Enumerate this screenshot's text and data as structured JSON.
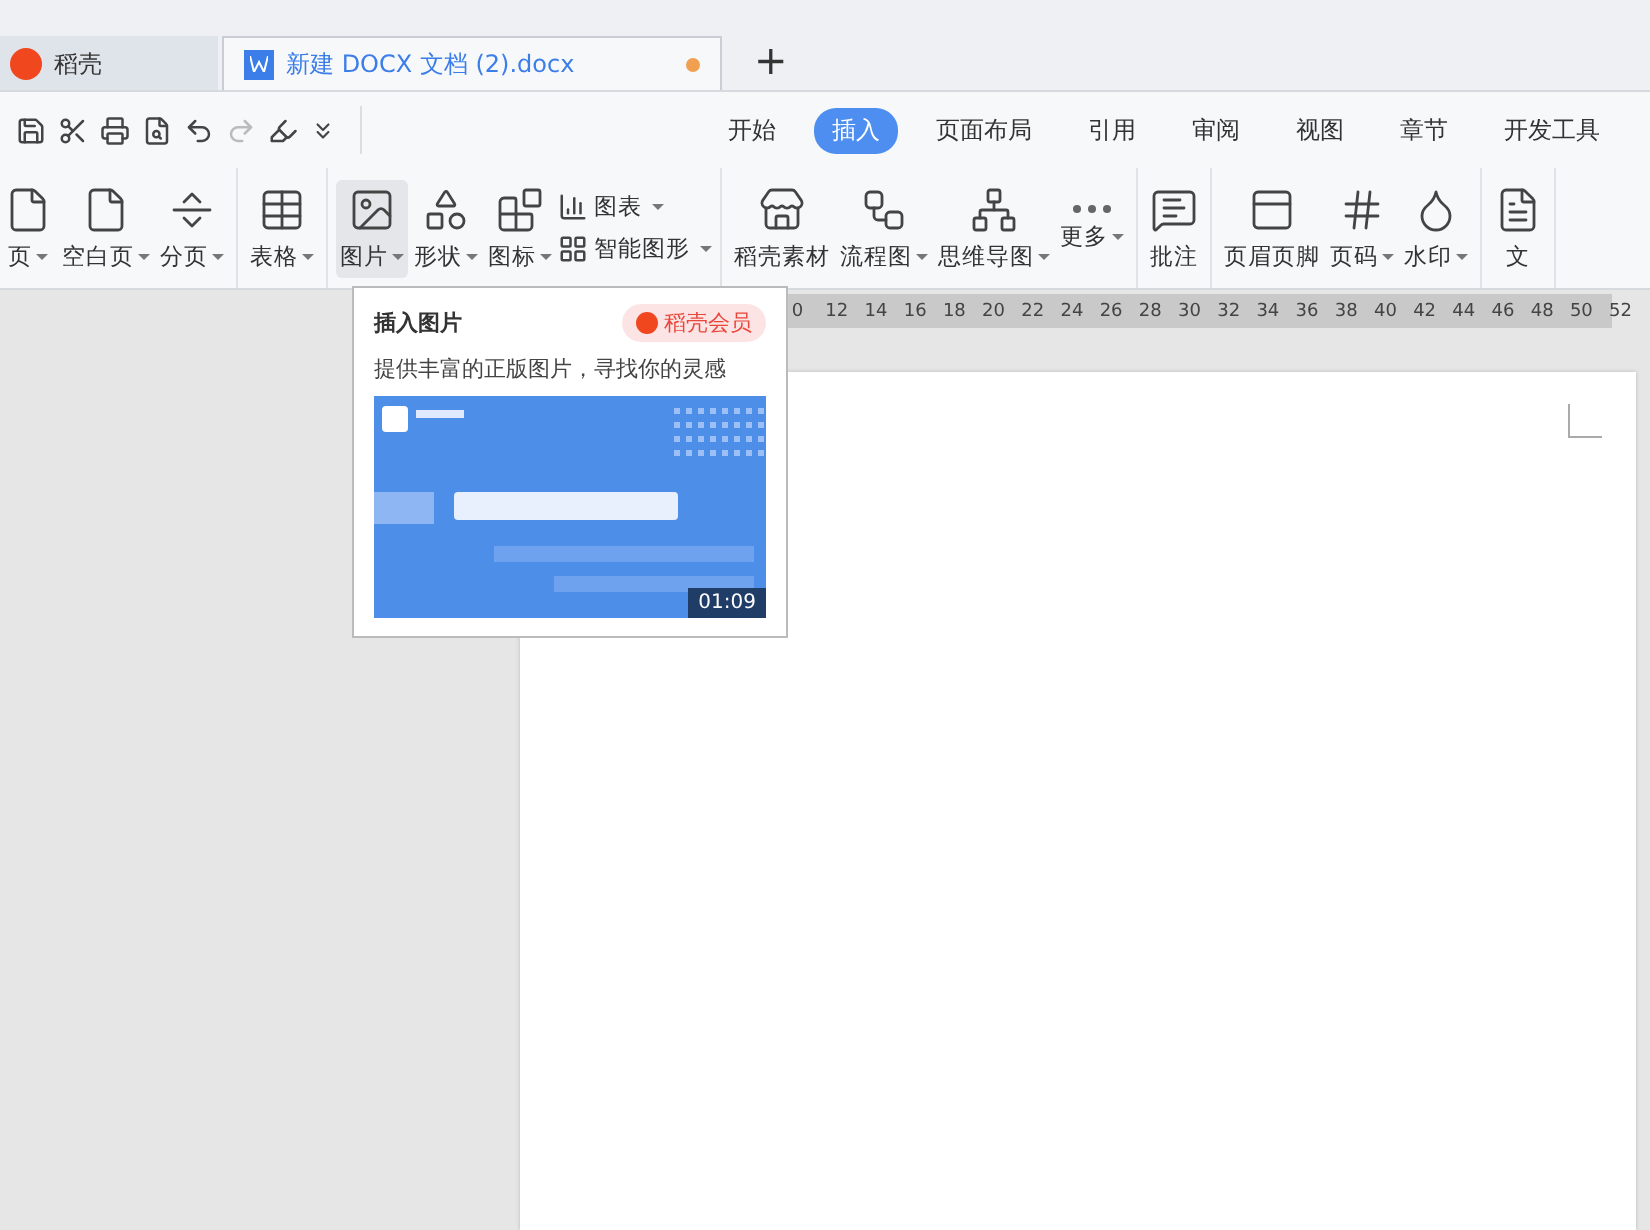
{
  "tabs": [
    {
      "label": "稻壳",
      "selected": false,
      "kind": "home"
    },
    {
      "label": "新建 DOCX 文档 (2).docx",
      "selected": true,
      "kind": "doc",
      "unsaved": true
    }
  ],
  "new_tab": "+",
  "menu_tabs": [
    {
      "label": "开始",
      "selected": false
    },
    {
      "label": "插入",
      "selected": true
    },
    {
      "label": "页面布局",
      "selected": false
    },
    {
      "label": "引用",
      "selected": false
    },
    {
      "label": "审阅",
      "selected": false
    },
    {
      "label": "视图",
      "selected": false
    },
    {
      "label": "章节",
      "selected": false
    },
    {
      "label": "开发工具",
      "selected": false
    }
  ],
  "ribbon_groups": [
    [
      {
        "kind": "big",
        "label": "页",
        "dropdown": true,
        "selected": false
      },
      {
        "kind": "big",
        "label": "空白页",
        "dropdown": true,
        "selected": false
      },
      {
        "kind": "big",
        "label": "分页",
        "dropdown": true,
        "selected": false
      }
    ],
    [
      {
        "kind": "big",
        "label": "表格",
        "dropdown": true,
        "selected": false
      }
    ],
    [
      {
        "kind": "big",
        "label": "图片",
        "dropdown": true,
        "selected": true
      },
      {
        "kind": "big",
        "label": "形状",
        "dropdown": true,
        "selected": false
      },
      {
        "kind": "big",
        "label": "图标",
        "dropdown": true,
        "selected": false
      },
      {
        "kind": "small",
        "items": [
          {
            "label": "图表",
            "dropdown": true
          },
          {
            "label": "智能图形",
            "dropdown": true
          }
        ]
      }
    ],
    [
      {
        "kind": "big",
        "label": "稻壳素材",
        "dropdown": false,
        "selected": false
      },
      {
        "kind": "big",
        "label": "流程图",
        "dropdown": true,
        "selected": false
      },
      {
        "kind": "big",
        "label": "思维导图",
        "dropdown": true,
        "selected": false
      },
      {
        "kind": "big",
        "label": "更多",
        "dropdown": true,
        "selected": false
      }
    ],
    [
      {
        "kind": "big",
        "label": "批注",
        "dropdown": false,
        "selected": false
      }
    ],
    [
      {
        "kind": "big",
        "label": "页眉页脚",
        "dropdown": false,
        "selected": false
      },
      {
        "kind": "big",
        "label": "页码",
        "dropdown": true,
        "selected": false
      },
      {
        "kind": "big",
        "label": "水印",
        "dropdown": true,
        "selected": false
      }
    ],
    [
      {
        "kind": "big",
        "label": "文",
        "dropdown": false,
        "selected": false
      }
    ]
  ],
  "ruler": [
    "0",
    "12",
    "14",
    "16",
    "18",
    "20",
    "22",
    "24",
    "26",
    "28",
    "30",
    "32",
    "34",
    "36",
    "38",
    "40",
    "42",
    "44",
    "46",
    "48",
    "50",
    "52"
  ],
  "popup": {
    "title": "插入图片",
    "badge": "稻壳会员",
    "description": "提供丰富的正版图片，寻找你的灵感",
    "video": {
      "kind": "picture",
      "duration": "01:09"
    }
  }
}
